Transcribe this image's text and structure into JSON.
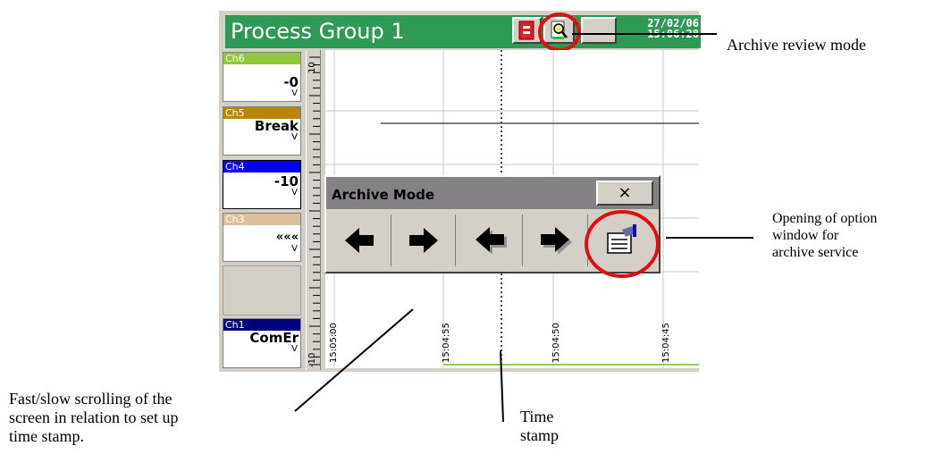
{
  "window": {
    "title": "Process Group 1",
    "date": "27/02/06",
    "time": "15:06:28",
    "accent_color": "#2f9a56"
  },
  "toolbar": {
    "buttons": [
      {
        "name": "alarm-icon"
      },
      {
        "name": "archive-review-icon"
      },
      {
        "name": "blank-button"
      }
    ]
  },
  "channels": [
    {
      "label": "Ch6",
      "value": "-0",
      "unit": "V",
      "color": "#8fc93a"
    },
    {
      "label": "Ch5",
      "value": "Break",
      "unit": "V",
      "color": "#b8860b"
    },
    {
      "label": "Ch4",
      "value": "-10",
      "unit": "V",
      "color": "#0000ee"
    },
    {
      "label": "Ch3",
      "value": "«««",
      "unit": "V",
      "color": "#dcc09a"
    },
    {
      "label": "Ch1",
      "value": "ComEr",
      "unit": "V",
      "color": "#000080"
    }
  ],
  "scale": {
    "top": "10",
    "bottom": "-10"
  },
  "time_ticks": [
    "15:05:00",
    "15:04:55",
    "15:04:50",
    "15:04:45"
  ],
  "archive_dialog": {
    "title": "Archive Mode",
    "close": "×",
    "buttons": [
      {
        "name": "fast-back-icon"
      },
      {
        "name": "fast-forward-icon"
      },
      {
        "name": "slow-back-icon"
      },
      {
        "name": "slow-forward-icon"
      },
      {
        "name": "archive-options-icon"
      }
    ]
  },
  "annotations": {
    "archive_review": "Archive review mode",
    "options_window": [
      "Opening of option",
      "window for",
      "archive service"
    ],
    "scrolling": [
      "Fast/slow scrolling  of the",
      "screen in relation to set up",
      "time stamp."
    ],
    "time_stamp": [
      "Time",
      "stamp"
    ]
  }
}
